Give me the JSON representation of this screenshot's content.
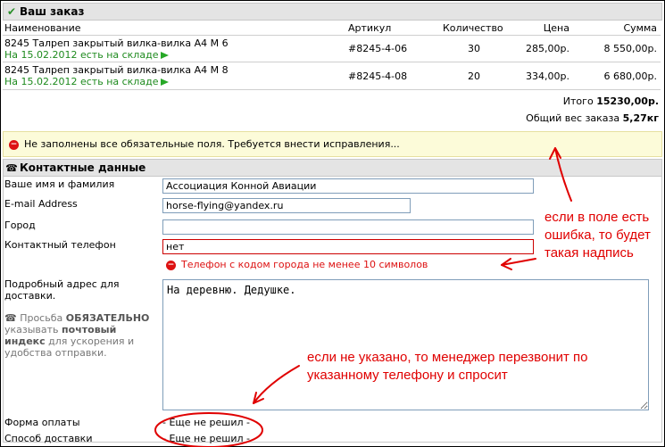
{
  "order": {
    "title": "Ваш заказ",
    "columns": [
      "Наименование",
      "Артикул",
      "Количество",
      "Цена",
      "Сумма"
    ],
    "items": [
      {
        "name": "8245 Талреп закрытый вилка-вилка А4 М 6",
        "stock": "На 15.02.2012 есть на складе",
        "sku": "#8245-4-06",
        "qty": "30",
        "price": "285,00р.",
        "sum": "8 550,00р."
      },
      {
        "name": "8245 Талреп закрытый вилка-вилка А4 М 8",
        "stock": "На 15.02.2012 есть на складе",
        "sku": "#8245-4-08",
        "qty": "20",
        "price": "334,00р.",
        "sum": "6 680,00р."
      }
    ],
    "total_label": "Итого",
    "total_value": "15230,00р.",
    "weight_label": "Общий вес заказа",
    "weight_value": "5,27кг"
  },
  "alert": {
    "text": "Не заполнены все обязательные поля. Требуется внести исправления..."
  },
  "contacts": {
    "title": "Контактные данные",
    "name_label": "Ваше имя и фамилия",
    "name_value": "Ассоциация Конной Авиации",
    "email_label": "E-mail Address",
    "email_value": "horse-flying@yandex.ru",
    "city_label": "Город",
    "city_value": "",
    "phone_label": "Контактный телефон",
    "phone_value": "нет",
    "phone_error": "Телефон с кодом города не менее 10 символов",
    "address_label": "Подробный адрес для доставки.",
    "address_hint_1": "Просьба ",
    "address_hint_bold1": "ОБЯЗАТЕЛЬНО",
    "address_hint_2": " указывать ",
    "address_hint_bold2": "почтовый индекс",
    "address_hint_3": " для ускорения и удобства отправки.",
    "address_value": "На деревню. Дедушке.",
    "payment_label": "Форма оплаты",
    "payment_value": "- Еще не решил -",
    "delivery_label": "Способ доставки",
    "delivery_value": "- Еще не решил -"
  },
  "annotations": {
    "error_note": "если в поле есть ошибка, то будет такая надпись",
    "manager_note": "если не указано, то менеджер перезвонит по указанному телефону и спросит"
  }
}
